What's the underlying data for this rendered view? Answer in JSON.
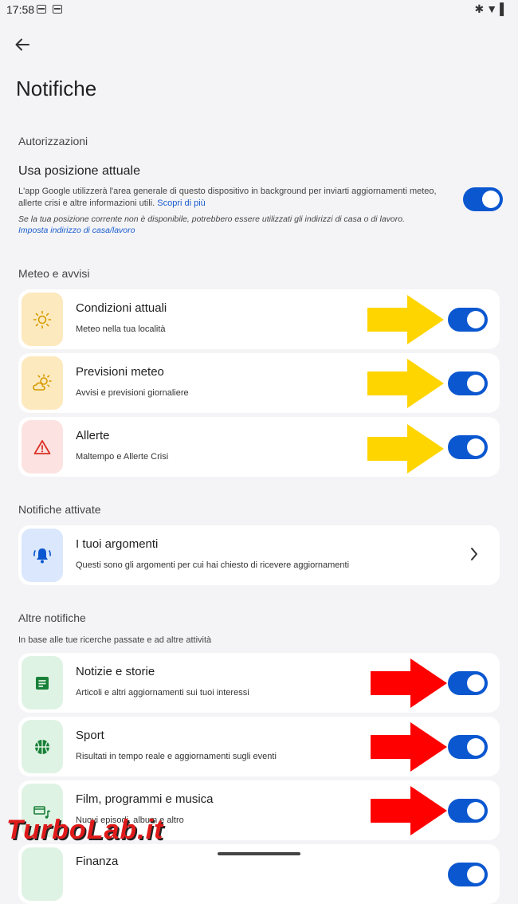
{
  "status": {
    "time": "17:58",
    "icons_right": [
      "bluetooth-icon",
      "wifi-icon",
      "battery-icon"
    ]
  },
  "page_title": "Notifiche",
  "permissions": {
    "heading": "Autorizzazioni",
    "location_title": "Usa posizione attuale",
    "location_desc": "L'app Google utilizzerà l'area generale di questo dispositivo in background per inviarti aggiornamenti meteo, allerte crisi e altre informazioni utili.",
    "location_link": "Scopri di più",
    "location_note": "Se la tua posizione corrente non è disponibile, potrebbero essere utilizzati gli indirizzi di casa o di lavoro.",
    "location_note_link": "Imposta indirizzo di casa/lavoro",
    "location_enabled": true
  },
  "weather": {
    "heading": "Meteo e avvisi",
    "items": [
      {
        "title": "Condizioni attuali",
        "subtitle": "Meteo nella tua località",
        "icon": "sun-icon",
        "enabled": true
      },
      {
        "title": "Previsioni meteo",
        "subtitle": "Avvisi e previsioni giornaliere",
        "icon": "partly-cloudy-icon",
        "enabled": true
      },
      {
        "title": "Allerte",
        "subtitle": "Maltempo e Allerte Crisi",
        "icon": "warning-icon",
        "enabled": true
      }
    ]
  },
  "active": {
    "heading": "Notifiche attivate",
    "item": {
      "title": "I tuoi argomenti",
      "subtitle": "Questi sono gli argomenti per cui hai chiesto di ricevere aggiornamenti",
      "icon": "bell-icon"
    }
  },
  "other": {
    "heading": "Altre notifiche",
    "caption": "In base alle tue ricerche passate e ad altre attività",
    "items": [
      {
        "title": "Notizie e storie",
        "subtitle": "Articoli e altri aggiornamenti sui tuoi interessi",
        "icon": "article-icon",
        "enabled": true
      },
      {
        "title": "Sport",
        "subtitle": "Risultati in tempo reale e aggiornamenti sugli eventi",
        "icon": "basketball-icon",
        "enabled": true
      },
      {
        "title": "Film, programmi e musica",
        "subtitle": "Nuovi episodi, album e altro",
        "icon": "media-icon",
        "enabled": true
      },
      {
        "title": "Finanza",
        "subtitle": "",
        "icon": "finance-icon",
        "enabled": true
      }
    ]
  },
  "colors": {
    "accent": "#0b57d0",
    "yellow_arrow": "#ffd500",
    "red_arrow": "#ff0000"
  },
  "watermark": "TurboLab.it"
}
